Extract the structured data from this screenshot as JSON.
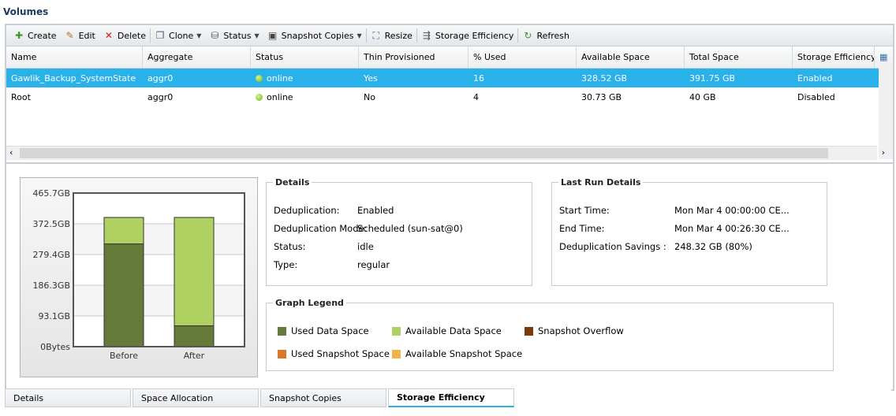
{
  "title": "Volumes",
  "toolbar": [
    {
      "label": "Create",
      "icon": "create-icon"
    },
    {
      "label": "Edit",
      "icon": "edit-icon"
    },
    {
      "label": "Delete",
      "icon": "delete-icon"
    },
    {
      "label": "Clone",
      "icon": "clone-icon",
      "dropdown": true
    },
    {
      "label": "Status",
      "icon": "status-icon",
      "dropdown": true
    },
    {
      "label": "Snapshot Copies",
      "icon": "snapshot-icon",
      "dropdown": true
    },
    {
      "label": "Resize",
      "icon": "resize-icon"
    },
    {
      "label": "Storage Efficiency",
      "icon": "storage-efficiency-icon"
    },
    {
      "label": "Refresh",
      "icon": "refresh-icon"
    }
  ],
  "table": {
    "columns": [
      "Name",
      "Aggregate",
      "Status",
      "Thin Provisioned",
      "% Used",
      "Available Space",
      "Total Space",
      "Storage Efficiency"
    ],
    "rows": [
      [
        "Gawlik_Backup_SystemState",
        "aggr0",
        "online",
        "Yes",
        "16",
        "328.52 GB",
        "391.75 GB",
        "Enabled"
      ],
      [
        "Root",
        "aggr0",
        "online",
        "No",
        "4",
        "30.73 GB",
        "40 GB",
        "Disabled"
      ]
    ],
    "selected_row": 0
  },
  "details": {
    "title": "Details",
    "items": [
      [
        "Deduplication:",
        "Enabled"
      ],
      [
        "Deduplication Mode:",
        "Scheduled (sun-sat@0)"
      ],
      [
        "Status:",
        "idle"
      ],
      [
        "Type:",
        "regular"
      ]
    ]
  },
  "last_run": {
    "title": "Last Run Details",
    "items": [
      [
        "Start Time:",
        "Mon Mar 4 00:00:00 CE..."
      ],
      [
        "End Time:",
        "Mon Mar 4 00:26:30 CE..."
      ],
      [
        "Deduplication Savings :",
        "248.32 GB (80%)"
      ]
    ]
  },
  "graph_legend": {
    "title": "Graph Legend",
    "items": [
      {
        "label": "Used Data Space",
        "color": "#65793a"
      },
      {
        "label": "Available Data Space",
        "color": "#afd162"
      },
      {
        "label": "Snapshot Overflow",
        "color": "#7a3a0c"
      },
      {
        "label": "Used Snapshot Space",
        "color": "#d9772a"
      },
      {
        "label": "Available Snapshot Space",
        "color": "#f2b24d"
      }
    ]
  },
  "chart_data": {
    "type": "bar",
    "stacked": true,
    "categories": [
      "Before",
      "After"
    ],
    "series": [
      {
        "name": "Used Data Space",
        "values": [
          311.5,
          63.2
        ],
        "color": "#65793a"
      },
      {
        "name": "Available Data Space",
        "values": [
          80.2,
          328.5
        ],
        "color": "#afd162"
      }
    ],
    "ylim": [
      0,
      465.7
    ],
    "yticks": [
      "0Bytes",
      "93.1GB",
      "186.3GB",
      "279.4GB",
      "372.5GB",
      "465.7GB"
    ],
    "ytick_values": [
      0,
      93.1,
      186.3,
      279.4,
      372.5,
      465.7
    ],
    "grid": true
  },
  "tabs": [
    "Details",
    "Space Allocation",
    "Snapshot Copies",
    "Storage Efficiency"
  ],
  "active_tab": 3
}
